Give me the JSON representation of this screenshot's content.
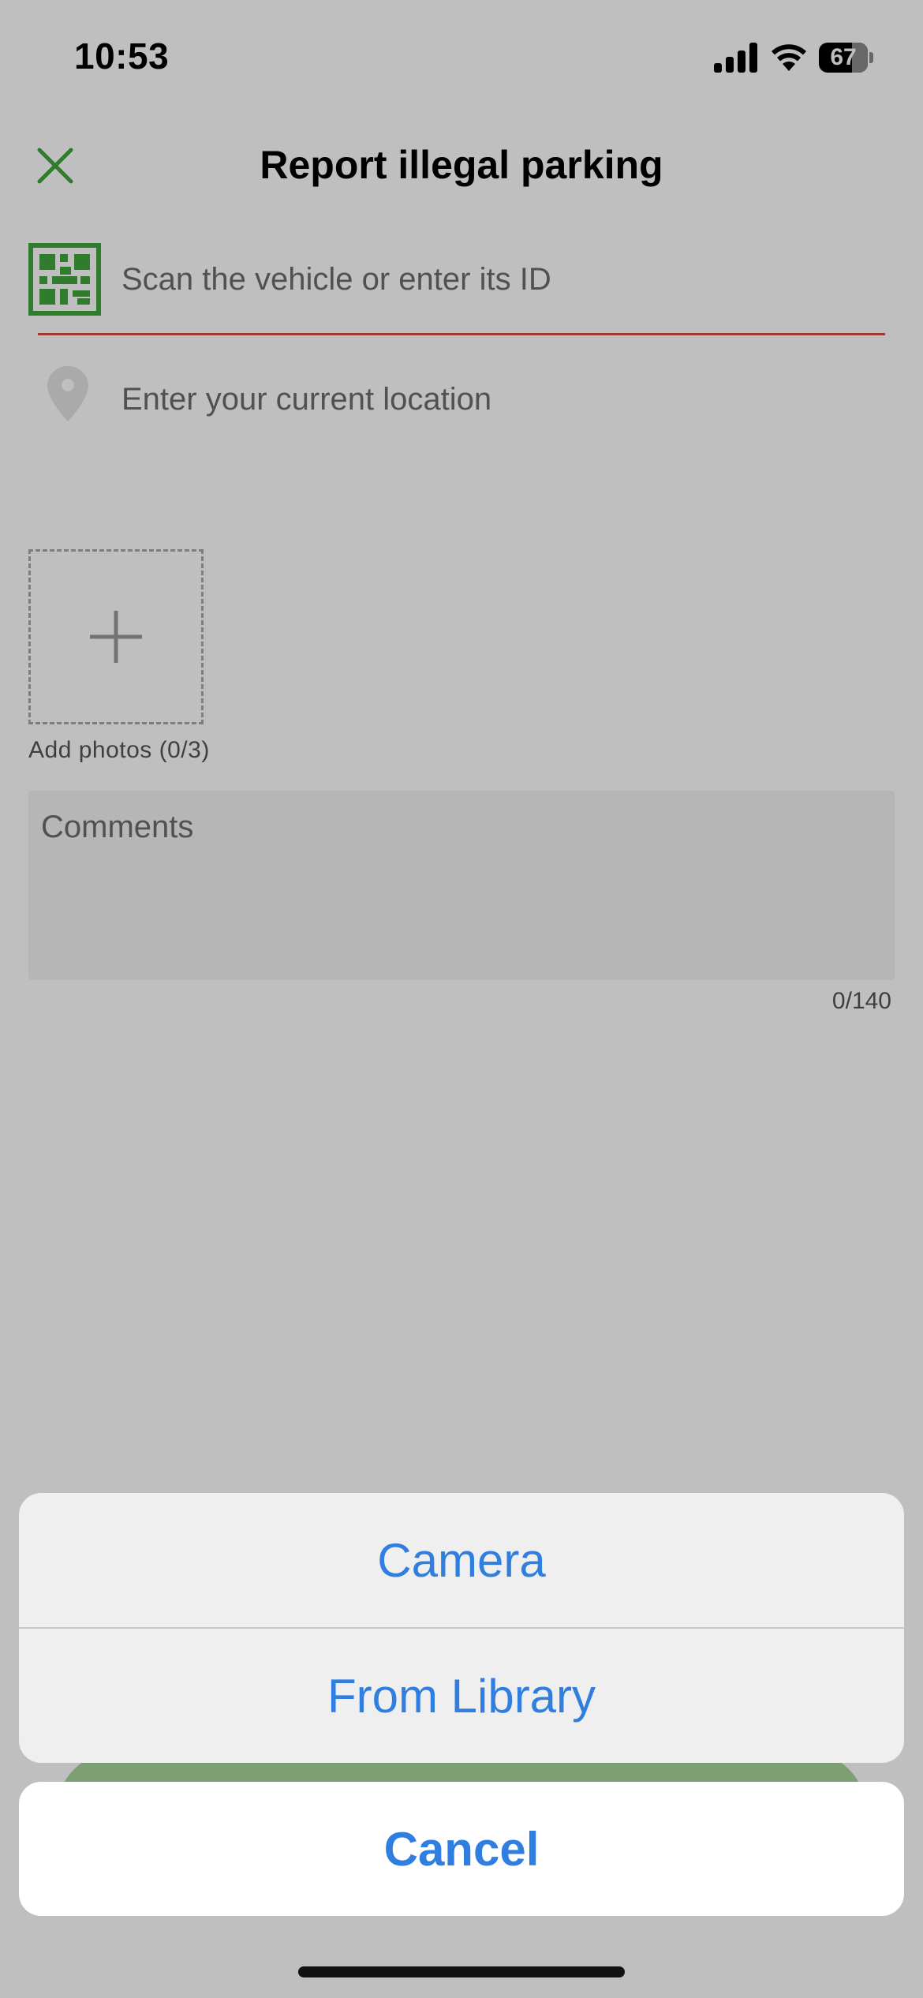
{
  "status_bar": {
    "time": "10:53",
    "battery_level": "67",
    "battery_fraction": 0.67
  },
  "nav": {
    "title": "Report illegal parking",
    "close_icon": "close-icon",
    "accent_color": "#3ea63b"
  },
  "form": {
    "vehicle_placeholder": "Scan the vehicle or enter its ID",
    "vehicle_icon": "qr-code-icon",
    "location_placeholder": "Enter your current location",
    "location_icon": "location-pin-icon",
    "add_photos_label": "Add photos (0/3)",
    "comments_placeholder": "Comments",
    "char_count": "0/140",
    "error_underline_color": "#d94b3f"
  },
  "action_sheet": {
    "camera_label": "Camera",
    "library_label": "From Library",
    "cancel_label": "Cancel",
    "action_color": "#2f7ee0"
  }
}
